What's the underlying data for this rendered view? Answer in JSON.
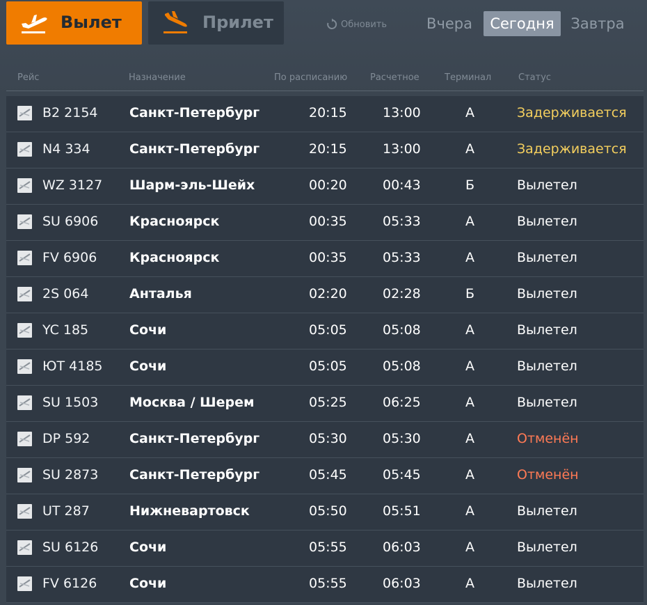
{
  "tabs": {
    "departures": "Вылет",
    "arrivals": "Прилет"
  },
  "refresh_label": "Обновить",
  "days": {
    "yesterday": "Вчера",
    "today": "Сегодня",
    "tomorrow": "Завтра",
    "selected": "today"
  },
  "colors": {
    "accent": "#f07c00",
    "delayed": "#f4cf5e",
    "cancelled": "#ff7a55"
  },
  "columns": {
    "flight": "Рейс",
    "destination": "Назначение",
    "scheduled": "По расписанию",
    "estimated": "Расчетное",
    "terminal": "Терминал",
    "status": "Статус"
  },
  "flights": [
    {
      "logo": "airline-logo-b2",
      "flight": "B2 2154",
      "destination": "Санкт-Петербург",
      "scheduled": "20:15",
      "estimated": "13:00",
      "terminal": "А",
      "status": "Задерживается",
      "status_type": "delayed"
    },
    {
      "logo": "airline-logo-n4",
      "flight": "N4 334",
      "destination": "Санкт-Петербург",
      "scheduled": "20:15",
      "estimated": "13:00",
      "terminal": "А",
      "status": "Задерживается",
      "status_type": "delayed"
    },
    {
      "logo": "airline-logo-wz",
      "flight": "WZ 3127",
      "destination": "Шарм-эль-Шейх",
      "scheduled": "00:20",
      "estimated": "00:43",
      "terminal": "Б",
      "status": "Вылетел",
      "status_type": "departed"
    },
    {
      "logo": "airline-logo-su",
      "flight": "SU 6906",
      "destination": "Красноярск",
      "scheduled": "00:35",
      "estimated": "05:33",
      "terminal": "А",
      "status": "Вылетел",
      "status_type": "departed"
    },
    {
      "logo": "airline-logo-fv",
      "flight": "FV 6906",
      "destination": "Красноярск",
      "scheduled": "00:35",
      "estimated": "05:33",
      "terminal": "А",
      "status": "Вылетел",
      "status_type": "departed"
    },
    {
      "logo": "airline-logo-2s",
      "flight": "2S 064",
      "destination": "Анталья",
      "scheduled": "02:20",
      "estimated": "02:28",
      "terminal": "Б",
      "status": "Вылетел",
      "status_type": "departed"
    },
    {
      "logo": "airline-logo-yc",
      "flight": "YC 185",
      "destination": "Сочи",
      "scheduled": "05:05",
      "estimated": "05:08",
      "terminal": "А",
      "status": "Вылетел",
      "status_type": "departed"
    },
    {
      "logo": "airline-logo-ut",
      "flight": "ЮТ 4185",
      "destination": "Сочи",
      "scheduled": "05:05",
      "estimated": "05:08",
      "terminal": "А",
      "status": "Вылетел",
      "status_type": "departed"
    },
    {
      "logo": "airline-logo-su",
      "flight": "SU 1503",
      "destination": "Москва / Шерем",
      "scheduled": "05:25",
      "estimated": "06:25",
      "terminal": "А",
      "status": "Вылетел",
      "status_type": "departed"
    },
    {
      "logo": "airline-logo-dp",
      "flight": "DP 592",
      "destination": "Санкт-Петербург",
      "scheduled": "05:30",
      "estimated": "05:30",
      "terminal": "А",
      "status": "Отменён",
      "status_type": "cancelled"
    },
    {
      "logo": "airline-logo-su",
      "flight": "SU 2873",
      "destination": "Санкт-Петербург",
      "scheduled": "05:45",
      "estimated": "05:45",
      "terminal": "А",
      "status": "Отменён",
      "status_type": "cancelled"
    },
    {
      "logo": "airline-logo-ut",
      "flight": "UT 287",
      "destination": "Нижневартовск",
      "scheduled": "05:50",
      "estimated": "05:51",
      "terminal": "А",
      "status": "Вылетел",
      "status_type": "departed"
    },
    {
      "logo": "airline-logo-su",
      "flight": "SU 6126",
      "destination": "Сочи",
      "scheduled": "05:55",
      "estimated": "06:03",
      "terminal": "А",
      "status": "Вылетел",
      "status_type": "departed"
    },
    {
      "logo": "airline-logo-fv",
      "flight": "FV 6126",
      "destination": "Сочи",
      "scheduled": "05:55",
      "estimated": "06:03",
      "terminal": "А",
      "status": "Вылетел",
      "status_type": "departed"
    }
  ]
}
